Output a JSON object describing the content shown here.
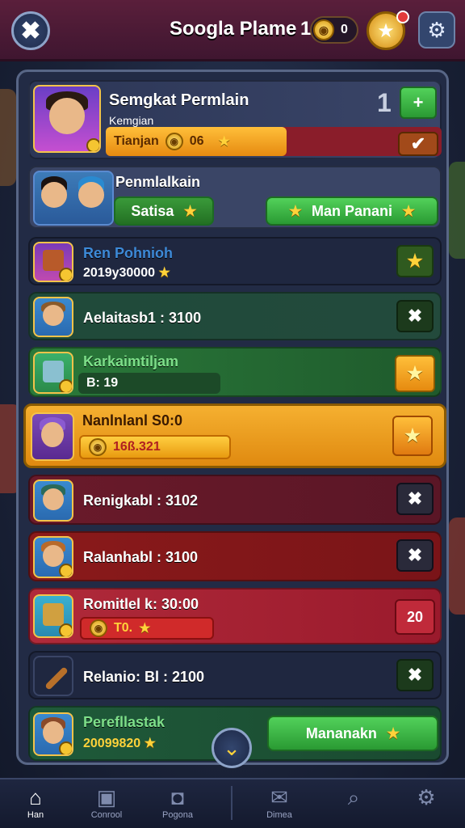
{
  "topbar": {
    "close_icon": "✖",
    "title": "Soogla Plame",
    "title_number": "1",
    "coin_symbol": "◉",
    "coin_value": "0",
    "medal_icon": "★",
    "settings_icon": "⚙"
  },
  "featured": {
    "name": "Semgkat Permlain",
    "subtitle": "Kemgian",
    "count": "1",
    "add_icon": "+",
    "progress_label": "Tianjan",
    "progress_value": "06",
    "check_icon": "✔"
  },
  "pair": {
    "name": "Penmlalkain",
    "left_button": "Satisa",
    "right_button": "Man Panani"
  },
  "rows": [
    {
      "name": "Ren Pohnioh",
      "sub": "2019y30000",
      "action": "★"
    },
    {
      "name": "Aelaitasb1 : 3100",
      "sub": "",
      "action": "✖"
    },
    {
      "name": "Karkaimtiljam",
      "sub": "B: 19",
      "action": "★"
    },
    {
      "name": "Nanlnlanl S0:0",
      "sub": "16ß.321",
      "action": "★"
    },
    {
      "name": "Renigkabl : 3102",
      "sub": "",
      "action": "✖"
    },
    {
      "name": "Ralanhabl : 3100",
      "sub": "",
      "action": "✖"
    },
    {
      "name": "Romitlel k: 30:00",
      "sub": "T0.",
      "action": "20"
    },
    {
      "name": "Relanio: Bl : 2100",
      "sub": "",
      "action": "✖"
    },
    {
      "name": "Perefllastak",
      "sub": "20099820",
      "action": "Mananakn"
    }
  ],
  "chevron_icon": "⌄",
  "nav": [
    {
      "label": "Han",
      "icon": "⌂"
    },
    {
      "label": "Conrool",
      "icon": "▣"
    },
    {
      "label": "Pogona",
      "icon": "◘"
    },
    {
      "label": "Dimea",
      "icon": "✉"
    },
    {
      "label": "",
      "icon": "⌕"
    },
    {
      "label": "",
      "icon": "⚙"
    }
  ]
}
